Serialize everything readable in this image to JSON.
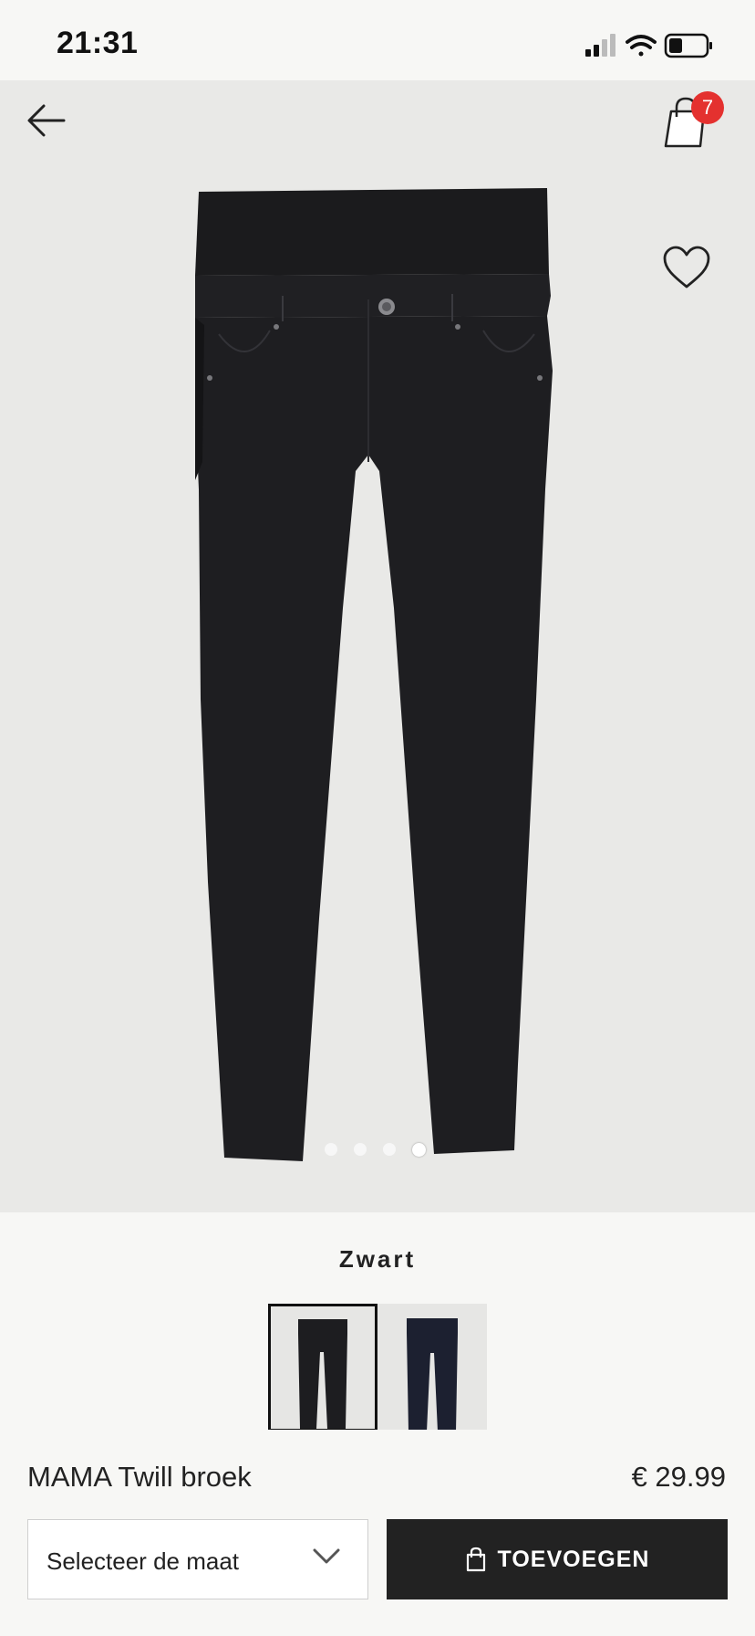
{
  "status_bar": {
    "time": "21:31"
  },
  "header": {
    "cart_count": "7"
  },
  "gallery": {
    "image_count": 4,
    "active_index": 4
  },
  "color": {
    "name": "Zwart",
    "swatches": [
      "Zwart",
      "Donkerblauw"
    ]
  },
  "product": {
    "name": "MAMA Twill broek",
    "price": "€ 29.99"
  },
  "size_select": {
    "label": "Selecteer de maat"
  },
  "add_button": {
    "label": "TOEVOEGEN"
  },
  "colors": {
    "badge": "#e4312f",
    "button": "#222222",
    "background": "#f7f7f5"
  }
}
